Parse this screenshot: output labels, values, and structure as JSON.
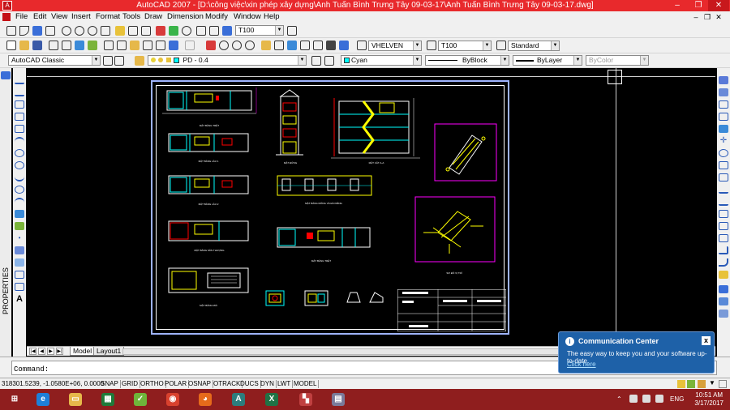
{
  "window": {
    "title": "AutoCAD 2007 - [D:\\công việc\\xin phép xây dựng\\Anh Tuấn Bình Trưng Tây 09-03-17\\Anh Tuấn Bình Trưng Tây 09-03-17.dwg]",
    "minimize": "–",
    "restore": "❐",
    "close": "✕"
  },
  "menu": [
    "File",
    "Edit",
    "View",
    "Insert",
    "Format",
    "Tools",
    "Draw",
    "Dimension",
    "Modify",
    "Window",
    "Help"
  ],
  "toolbar1": {
    "dimstyle": "T100"
  },
  "toolbar2": {
    "textstyle": "VHELVEN",
    "dimstyle": "T100",
    "tablestyle": "Standard"
  },
  "toolbar3": {
    "workspace": "AutoCAD Classic",
    "layer": "PD - 0.4",
    "color": "Cyan",
    "color_hex": "#00ffff",
    "linetype": "ByBlock",
    "lineweight": "ByLayer",
    "plotstyle": "ByColor"
  },
  "side_palette": {
    "label": "PROPERTIES"
  },
  "drawing": {
    "background": "#000000",
    "sheet_border_color": "#9fb4ff",
    "plans": [
      {
        "caption": "MẶT BẰNG TRỆT"
      },
      {
        "caption": "MẶT BẰNG LẦU 1"
      },
      {
        "caption": "MẶT BẰNG LẦU 2"
      },
      {
        "caption": "MẶT BẰNG SÂN THƯỢNG"
      },
      {
        "caption": "MẶT BẰNG MÁI"
      },
      {
        "caption": "MẶT ĐỨNG"
      },
      {
        "caption": "MẶT CẮT A-A"
      },
      {
        "caption": "MẶT BẰNG MÓNG VÀ ĐÀ KIỀNG"
      },
      {
        "caption": "MẶT BẰNG TRỆT"
      },
      {
        "caption": "SƠ ĐỒ VỊ TRÍ"
      }
    ]
  },
  "layout_tabs": {
    "nav": [
      "|◀",
      "◀",
      "▶",
      "▶|"
    ],
    "tabs": [
      "Model",
      "Layout1"
    ],
    "active": "Model"
  },
  "command": {
    "prompt": "Command:"
  },
  "status": {
    "coords": "318301.5239, -1.0580E+06, 0.0000",
    "toggles": [
      "SNAP",
      "GRID",
      "ORTHO",
      "POLAR",
      "OSNAP",
      "OTRACK",
      "DUCS",
      "DYN",
      "LWT",
      "MODEL"
    ]
  },
  "balloon": {
    "title": "Communication Center",
    "message": "The easy way to keep you and your software up-to-date.",
    "link": "Click here",
    "icon": "i",
    "close": "x"
  },
  "taskbar": {
    "language": "ENG",
    "time": "10:51 AM",
    "date": "3/17/2017",
    "apps": [
      {
        "name": "windows-start-icon",
        "color": "#8f1e1e",
        "glyph": "⊞"
      },
      {
        "name": "internet-explorer-icon",
        "color": "#1e7fd8",
        "glyph": "e"
      },
      {
        "name": "file-explorer-icon",
        "color": "#e6b84a",
        "glyph": "▭"
      },
      {
        "name": "excel-app-icon",
        "color": "#1f7a3a",
        "glyph": "▦"
      },
      {
        "name": "app-green-icon",
        "color": "#6fb53a",
        "glyph": "✓"
      },
      {
        "name": "chrome-icon",
        "color": "#d9412e",
        "glyph": "◉"
      },
      {
        "name": "firefox-icon",
        "color": "#e66a1a",
        "glyph": "◕"
      },
      {
        "name": "autocad-icon",
        "color": "#2c7d7d",
        "glyph": "A"
      },
      {
        "name": "excel-icon",
        "color": "#207245",
        "glyph": "X"
      },
      {
        "name": "paint-icon",
        "color": "#c04040",
        "glyph": "▚"
      },
      {
        "name": "calculator-icon",
        "color": "#7a7a9a",
        "glyph": "▤"
      }
    ]
  }
}
